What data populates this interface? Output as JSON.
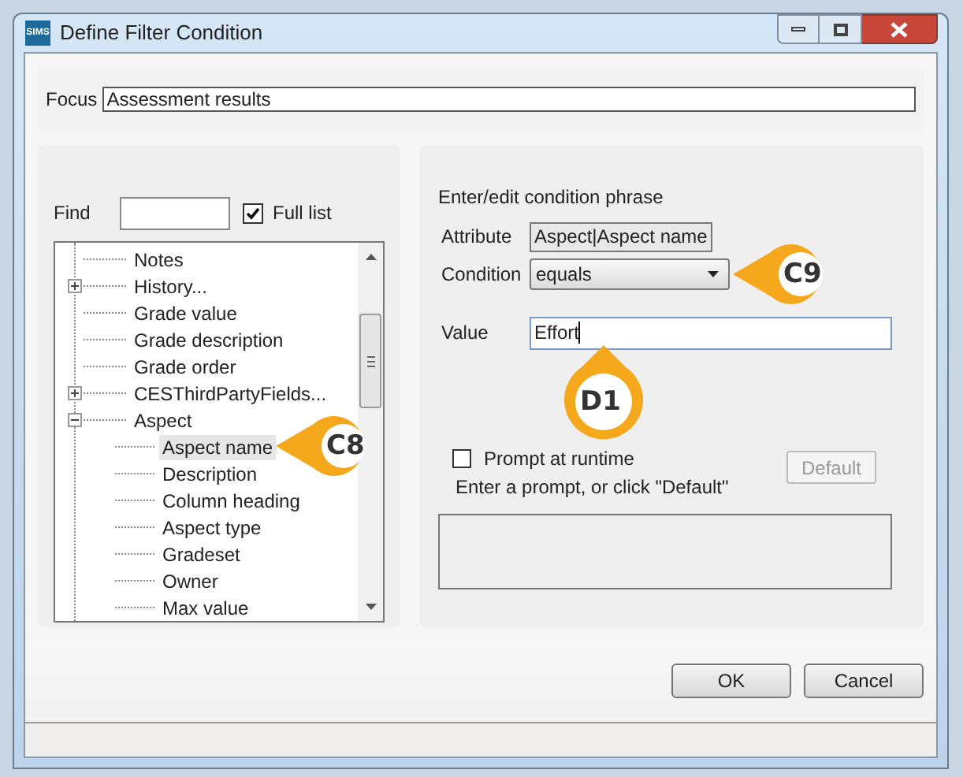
{
  "window": {
    "logo": "SIMS",
    "title": "Define Filter Condition"
  },
  "focus": {
    "label": "Focus",
    "value": "Assessment results"
  },
  "find": {
    "label": "Find",
    "full_list": {
      "label": "Full list",
      "checked": true
    }
  },
  "tree": [
    {
      "label": "Notes",
      "selected": false
    },
    {
      "label": "History...",
      "selected": false,
      "expanded": false
    },
    {
      "label": "Grade value",
      "selected": false
    },
    {
      "label": "Grade description",
      "selected": false
    },
    {
      "label": "Grade order",
      "selected": false
    },
    {
      "label": "CESThirdPartyFields...",
      "selected": false,
      "expanded": false
    },
    {
      "label": "Aspect",
      "selected": false,
      "expanded": true,
      "children": [
        {
          "label": "Aspect name",
          "selected": true,
          "callout": {
            "label": "C8"
          }
        },
        {
          "label": "Description",
          "selected": false
        },
        {
          "label": "Column heading",
          "selected": false
        },
        {
          "label": "Aspect type",
          "selected": false
        },
        {
          "label": "Gradeset",
          "selected": false
        },
        {
          "label": "Owner",
          "selected": false
        },
        {
          "label": "Max value",
          "selected": false
        }
      ]
    }
  ],
  "condition_phrase": {
    "heading": "Enter/edit condition phrase",
    "attribute": {
      "label": "Attribute",
      "value": "Aspect|Aspect name"
    },
    "condition": {
      "label": "Condition",
      "value": "equals",
      "callout": {
        "label": "C9"
      }
    },
    "value": {
      "label": "Value",
      "value": "Effort",
      "callout": {
        "label": "D1"
      }
    },
    "prompt": {
      "label": "Prompt at runtime",
      "checked": false,
      "hint": "Enter a prompt, or click \"Default\"",
      "default_button": {
        "label": "Default",
        "disabled": true
      }
    }
  },
  "buttons": [
    {
      "label": "OK"
    },
    {
      "label": "Cancel"
    }
  ]
}
